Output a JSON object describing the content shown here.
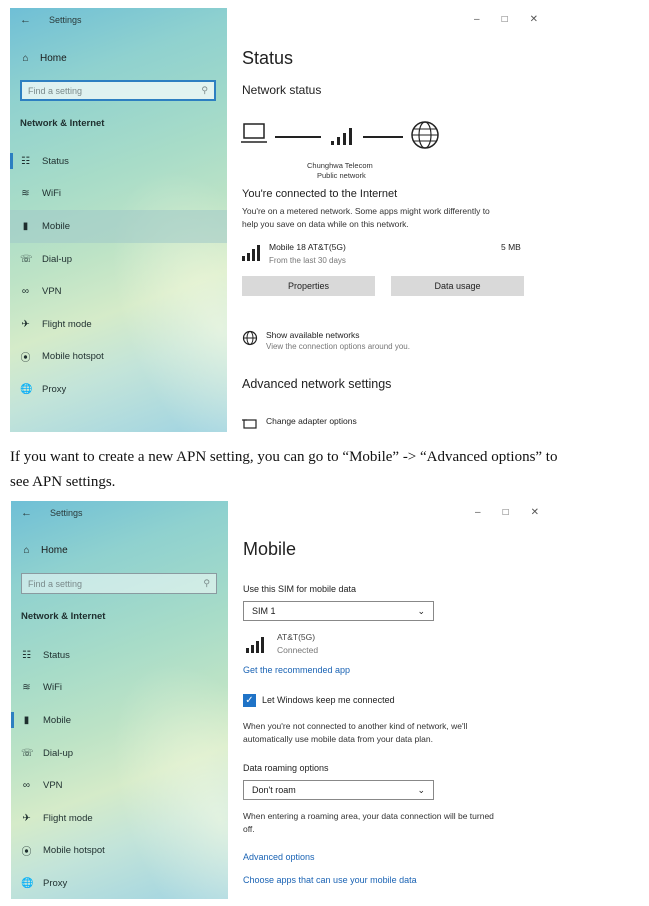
{
  "shot1": {
    "sidebar": {
      "window_title": "Settings",
      "home": "Home",
      "search_placeholder": "Find a setting",
      "section": "Network & Internet",
      "items": [
        {
          "label": "Status",
          "icon": "status-icon"
        },
        {
          "label": "WiFi",
          "icon": "wifi-icon"
        },
        {
          "label": "Mobile",
          "icon": "signal-icon"
        },
        {
          "label": "Dial-up",
          "icon": "phone-icon"
        },
        {
          "label": "VPN",
          "icon": "vpn-icon"
        },
        {
          "label": "Flight mode",
          "icon": "airplane-icon"
        },
        {
          "label": "Mobile hotspot",
          "icon": "hotspot-icon"
        },
        {
          "label": "Proxy",
          "icon": "globe-icon"
        }
      ],
      "active_item": "Status",
      "selected_item": "Mobile"
    },
    "main": {
      "title": "Status",
      "network_status": "Network status",
      "carrier_line1": "Chunghwa Telecom",
      "carrier_line2": "Public network",
      "connected_heading": "You're connected to the Internet",
      "metered_line1": "You're on a metered network. Some apps might work differently to",
      "metered_line2": "help you save on data while on this network.",
      "connection_name": "Mobile 18  AT&T(5G)",
      "connection_usage": "5 MB",
      "connection_period": "From the last 30 days",
      "properties_button": "Properties",
      "data_usage_button": "Data usage",
      "show_networks_title": "Show available networks",
      "show_networks_sub": "View the connection options around you.",
      "advanced_heading": "Advanced network settings",
      "change_adapter": "Change adapter options"
    }
  },
  "caption": {
    "line1": "If you want to create a new APN setting, you can go to “Mobile” -> “Advanced options” to",
    "line2": "see APN settings."
  },
  "shot2": {
    "sidebar": {
      "window_title": "Settings",
      "home": "Home",
      "search_placeholder": "Find a setting",
      "section": "Network & Internet",
      "items": [
        {
          "label": "Status",
          "icon": "status-icon"
        },
        {
          "label": "WiFi",
          "icon": "wifi-icon"
        },
        {
          "label": "Mobile",
          "icon": "signal-icon"
        },
        {
          "label": "Dial-up",
          "icon": "phone-icon"
        },
        {
          "label": "VPN",
          "icon": "vpn-icon"
        },
        {
          "label": "Flight mode",
          "icon": "airplane-icon"
        },
        {
          "label": "Mobile hotspot",
          "icon": "hotspot-icon"
        },
        {
          "label": "Proxy",
          "icon": "globe-icon"
        }
      ],
      "active_item": "Mobile"
    },
    "main": {
      "title": "Mobile",
      "sim_label": "Use this SIM for mobile data",
      "sim_value": "SIM 1",
      "carrier": "AT&T(5G)",
      "carrier_status": "Connected",
      "recommended_app": "Get the recommended app",
      "keep_connected": "Let Windows keep me connected",
      "keep_connected_desc1": "When you're not connected to another kind of network, we'll",
      "keep_connected_desc2": "automatically use mobile data from your data plan.",
      "roaming_label": "Data roaming options",
      "roaming_value": "Don't roam",
      "roaming_desc1": "When entering a roaming area, your data connection will be turned",
      "roaming_desc2": "off.",
      "advanced_options": "Advanced options",
      "choose_apps": "Choose apps that can use your mobile data"
    }
  },
  "colors": {
    "accent": "#2d7fc1",
    "link": "#1a63b4",
    "button": "#d9d9d9"
  }
}
